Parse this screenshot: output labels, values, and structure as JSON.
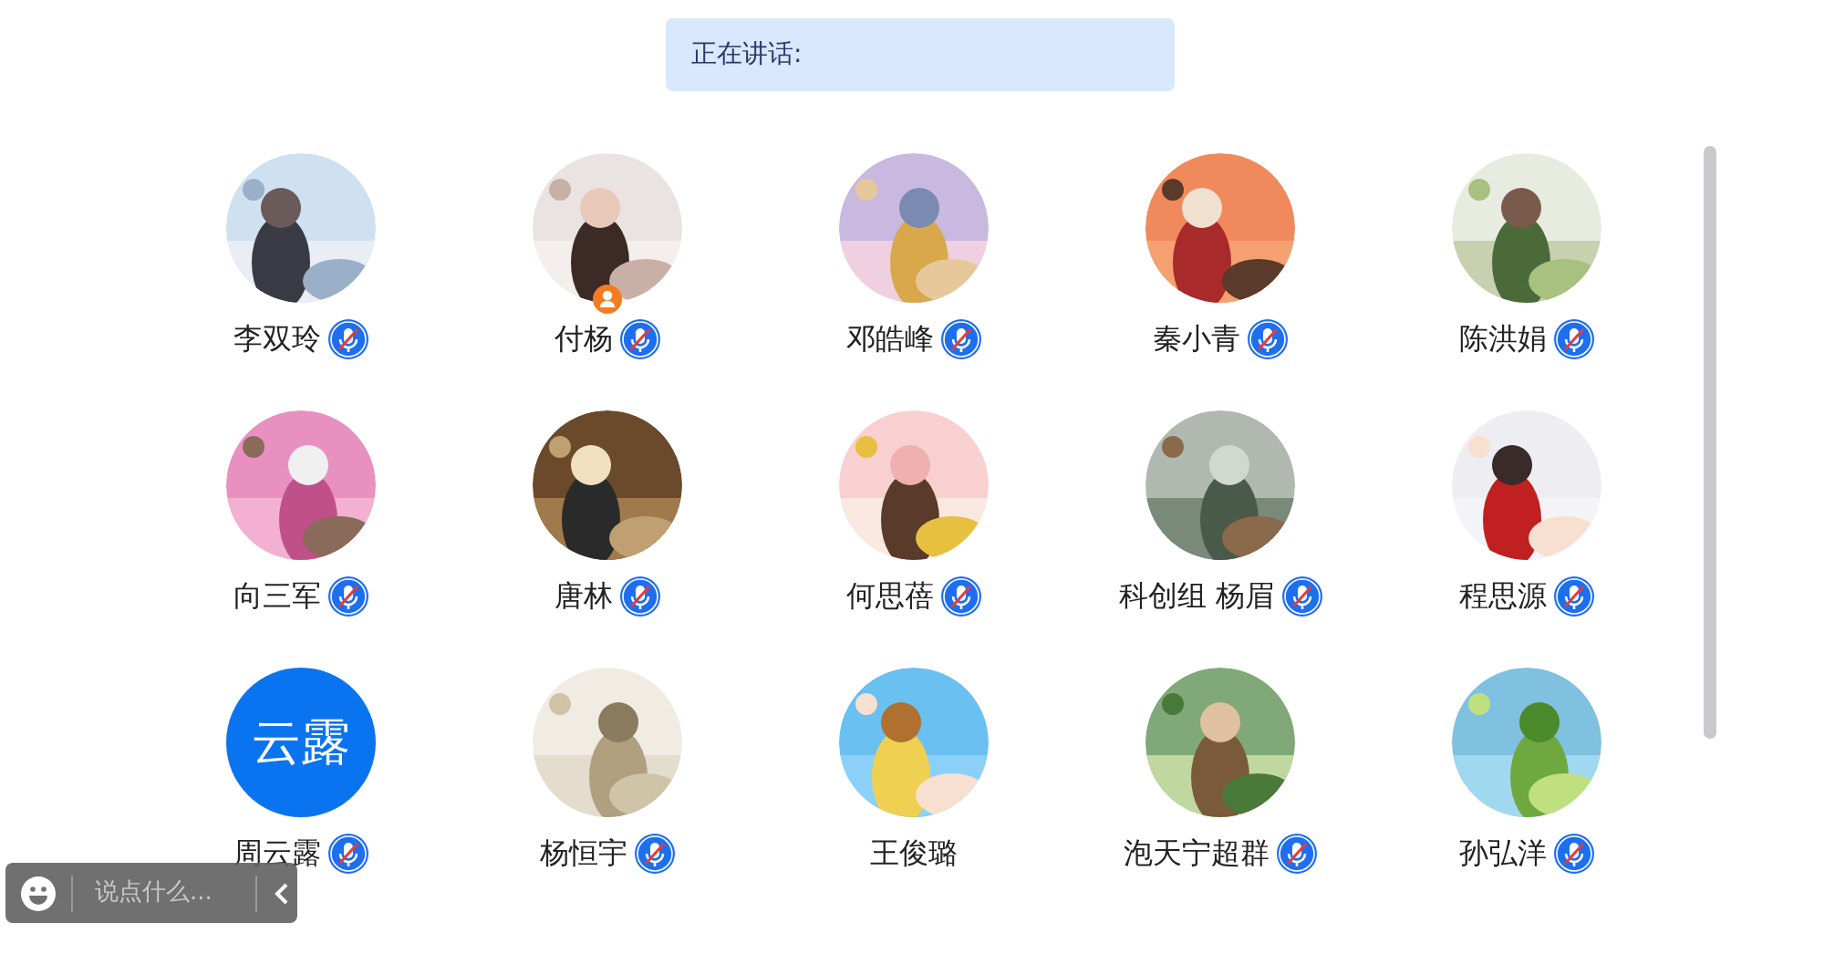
{
  "speaking_bar": {
    "label": "正在讲话:"
  },
  "participants": [
    {
      "name": "李双玲",
      "host": false,
      "mic_muted": true
    },
    {
      "name": "付杨",
      "host": true,
      "mic_muted": true
    },
    {
      "name": "邓皓峰",
      "host": false,
      "mic_muted": true
    },
    {
      "name": "秦小青",
      "host": false,
      "mic_muted": true
    },
    {
      "name": "陈洪娟",
      "host": false,
      "mic_muted": true
    },
    {
      "name": "向三军",
      "host": false,
      "mic_muted": true
    },
    {
      "name": "唐林",
      "host": false,
      "mic_muted": true
    },
    {
      "name": "何思蓓",
      "host": false,
      "mic_muted": true
    },
    {
      "name": "科创组 杨眉",
      "host": false,
      "mic_muted": true
    },
    {
      "name": "程思源",
      "host": false,
      "mic_muted": true
    },
    {
      "name": "周云露",
      "avatar": {
        "kind": "text",
        "text": "云露"
      },
      "host": false,
      "mic_muted": true
    },
    {
      "name": "杨恒宇",
      "host": false,
      "mic_muted": true
    },
    {
      "name": "王俊璐",
      "host": false
    },
    {
      "name": "泡天宁超群",
      "host": false,
      "mic_muted": true
    },
    {
      "name": "孙弘洋",
      "host": false,
      "mic_muted": true
    }
  ],
  "chat_bar": {
    "placeholder": "说点什么..."
  }
}
